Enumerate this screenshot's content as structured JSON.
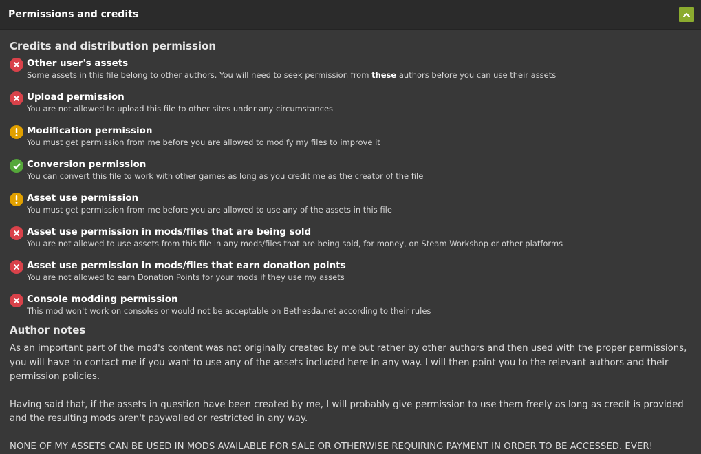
{
  "header": {
    "title": "Permissions and credits",
    "collapse_icon": "chevron-up-icon",
    "accent": "#8bab2f"
  },
  "credits": {
    "heading": "Credits and distribution permission",
    "items": [
      {
        "status": "deny",
        "icon": "cross-circle-icon",
        "title": "Other user's assets",
        "desc_pre": "Some assets in this file belong to other authors. You will need to seek permission from ",
        "desc_bold": "these",
        "desc_post": " authors before you can use their assets"
      },
      {
        "status": "deny",
        "icon": "cross-circle-icon",
        "title": "Upload permission",
        "desc": "You are not allowed to upload this file to other sites under any circumstances"
      },
      {
        "status": "warn",
        "icon": "exclamation-circle-icon",
        "title": "Modification permission",
        "desc": "You must get permission from me before you are allowed to modify my files to improve it"
      },
      {
        "status": "allow",
        "icon": "check-circle-icon",
        "title": "Conversion permission",
        "desc": "You can convert this file to work with other games as long as you credit me as the creator of the file"
      },
      {
        "status": "warn",
        "icon": "exclamation-circle-icon",
        "title": "Asset use permission",
        "desc": "You must get permission from me before you are allowed to use any of the assets in this file"
      },
      {
        "status": "deny",
        "icon": "cross-circle-icon",
        "title": "Asset use permission in mods/files that are being sold",
        "desc": "You are not allowed to use assets from this file in any mods/files that are being sold, for money, on Steam Workshop or other platforms"
      },
      {
        "status": "deny",
        "icon": "cross-circle-icon",
        "title": "Asset use permission in mods/files that earn donation points",
        "desc": "You are not allowed to earn Donation Points for your mods if they use my assets"
      },
      {
        "status": "deny",
        "icon": "cross-circle-icon",
        "title": "Console modding permission",
        "desc": "This mod won't work on consoles or would not be acceptable on Bethesda.net according to their rules"
      }
    ]
  },
  "notes": {
    "heading": "Author notes",
    "paragraphs": [
      "As an important part of the mod's content was not originally created by me but rather by other authors and then used with the proper permissions, you will have to contact me if you want to use any of the assets included here in any way. I will then point you to the relevant authors and their permission policies.",
      "Having said that, if the assets in question have been created by me, I will probably give permission to use them freely as long as credit is provided and the resulting mods aren't paywalled or restricted in any way.",
      "NONE OF MY ASSETS CAN BE USED IN MODS AVAILABLE FOR SALE OR OTHERWISE REQUIRING PAYMENT IN ORDER TO BE ACCESSED. EVER!"
    ]
  },
  "colors": {
    "deny": "#d9424a",
    "warn": "#e1a000",
    "allow": "#55a83a",
    "background": "#383838"
  }
}
